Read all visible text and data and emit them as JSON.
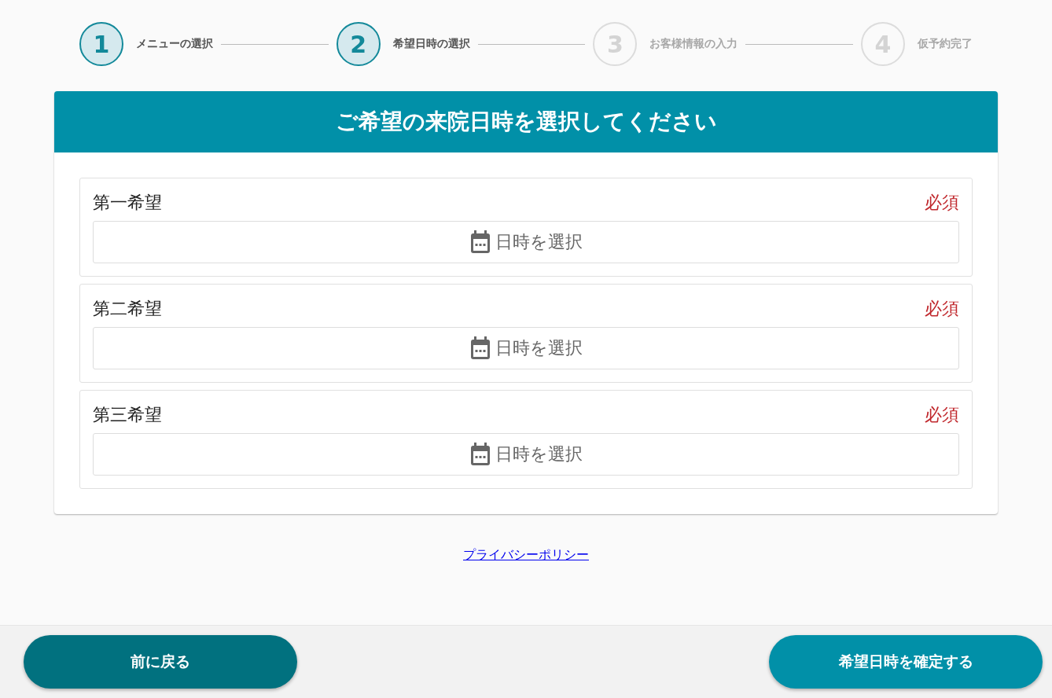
{
  "steps": [
    {
      "number": "1",
      "label": "メニューの選択",
      "active": true
    },
    {
      "number": "2",
      "label": "希望日時の選択",
      "active": true
    },
    {
      "number": "3",
      "label": "お客様情報の入力",
      "active": false
    },
    {
      "number": "4",
      "label": "仮予約完了",
      "active": false
    }
  ],
  "card": {
    "title": "ご希望の来院日時を選択してください",
    "choices": [
      {
        "label": "第一希望",
        "required": "必須",
        "placeholder": "日時を選択"
      },
      {
        "label": "第二希望",
        "required": "必須",
        "placeholder": "日時を選択"
      },
      {
        "label": "第三希望",
        "required": "必須",
        "placeholder": "日時を選択"
      }
    ]
  },
  "privacy_link": "プライバシーポリシー",
  "footer": {
    "back_button": "前に戻る",
    "confirm_button": "希望日時を確定する"
  }
}
